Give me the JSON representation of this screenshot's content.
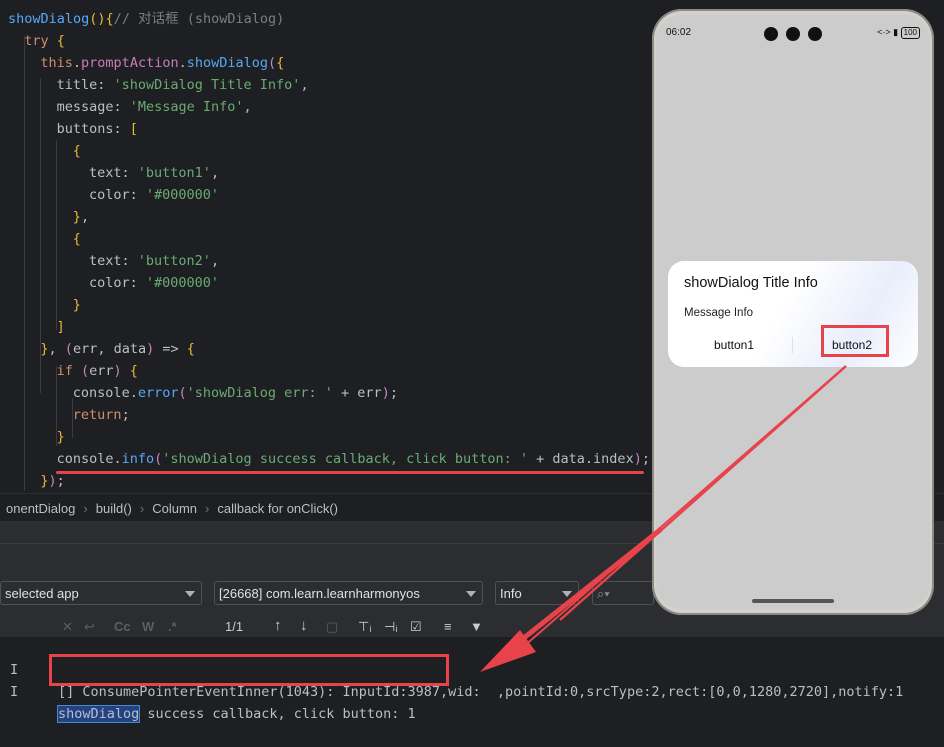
{
  "editor": {
    "lines": [
      {
        "indent": 0,
        "parts": [
          {
            "c": "fn",
            "t": "showDialog"
          },
          {
            "c": "br1",
            "t": "()"
          },
          {
            "c": "br1",
            "t": "{"
          },
          {
            "c": "cm",
            "t": "// 对话框 (showDialog)"
          }
        ]
      },
      {
        "indent": 1,
        "parts": [
          {
            "c": "kw",
            "t": "try "
          },
          {
            "c": "br1",
            "t": "{"
          }
        ]
      },
      {
        "indent": 2,
        "parts": [
          {
            "c": "kw",
            "t": "this"
          },
          {
            "c": "plain",
            "t": "."
          },
          {
            "c": "prop",
            "t": "promptAction"
          },
          {
            "c": "plain",
            "t": "."
          },
          {
            "c": "fn",
            "t": "showDialog"
          },
          {
            "c": "br2",
            "t": "("
          },
          {
            "c": "br1",
            "t": "{"
          }
        ]
      },
      {
        "indent": 3,
        "parts": [
          {
            "c": "plain",
            "t": "title: "
          },
          {
            "c": "str",
            "t": "'showDialog Title Info'"
          },
          {
            "c": "plain",
            "t": ","
          }
        ]
      },
      {
        "indent": 3,
        "parts": [
          {
            "c": "plain",
            "t": "message: "
          },
          {
            "c": "str",
            "t": "'Message Info'"
          },
          {
            "c": "plain",
            "t": ","
          }
        ]
      },
      {
        "indent": 3,
        "parts": [
          {
            "c": "plain",
            "t": "buttons: "
          },
          {
            "c": "br1",
            "t": "["
          }
        ]
      },
      {
        "indent": 4,
        "parts": [
          {
            "c": "br1",
            "t": "{"
          }
        ]
      },
      {
        "indent": 5,
        "parts": [
          {
            "c": "plain",
            "t": "text: "
          },
          {
            "c": "str",
            "t": "'button1'"
          },
          {
            "c": "plain",
            "t": ","
          }
        ]
      },
      {
        "indent": 5,
        "parts": [
          {
            "c": "plain",
            "t": "color: "
          },
          {
            "c": "str",
            "t": "'#000000'"
          }
        ]
      },
      {
        "indent": 4,
        "parts": [
          {
            "c": "br1",
            "t": "}"
          },
          {
            "c": "plain",
            "t": ","
          }
        ]
      },
      {
        "indent": 4,
        "parts": [
          {
            "c": "br1",
            "t": "{"
          }
        ]
      },
      {
        "indent": 5,
        "parts": [
          {
            "c": "plain",
            "t": "text: "
          },
          {
            "c": "str",
            "t": "'button2'"
          },
          {
            "c": "plain",
            "t": ","
          }
        ]
      },
      {
        "indent": 5,
        "parts": [
          {
            "c": "plain",
            "t": "color: "
          },
          {
            "c": "str",
            "t": "'#000000'"
          }
        ]
      },
      {
        "indent": 4,
        "parts": [
          {
            "c": "br1",
            "t": "}"
          }
        ]
      },
      {
        "indent": 3,
        "parts": [
          {
            "c": "br1",
            "t": "]"
          }
        ]
      },
      {
        "indent": 2,
        "parts": [
          {
            "c": "br1",
            "t": "}"
          },
          {
            "c": "plain",
            "t": ", "
          },
          {
            "c": "br2",
            "t": "("
          },
          {
            "c": "plain",
            "t": "err, data"
          },
          {
            "c": "br2",
            "t": ")"
          },
          {
            "c": "plain",
            "t": " => "
          },
          {
            "c": "br1",
            "t": "{"
          }
        ]
      },
      {
        "indent": 3,
        "parts": [
          {
            "c": "kw",
            "t": "if "
          },
          {
            "c": "br2",
            "t": "("
          },
          {
            "c": "plain",
            "t": "err"
          },
          {
            "c": "br2",
            "t": ")"
          },
          {
            "c": "plain",
            "t": " "
          },
          {
            "c": "br1",
            "t": "{"
          }
        ]
      },
      {
        "indent": 4,
        "parts": [
          {
            "c": "plain",
            "t": "console."
          },
          {
            "c": "fn",
            "t": "error"
          },
          {
            "c": "br2",
            "t": "("
          },
          {
            "c": "str",
            "t": "'showDialog err: '"
          },
          {
            "c": "plain",
            "t": " + err"
          },
          {
            "c": "br2",
            "t": ")"
          },
          {
            "c": "plain",
            "t": ";"
          }
        ]
      },
      {
        "indent": 4,
        "parts": [
          {
            "c": "kw",
            "t": "return"
          },
          {
            "c": "plain",
            "t": ";"
          }
        ]
      },
      {
        "indent": 3,
        "parts": [
          {
            "c": "br1",
            "t": "}"
          }
        ]
      },
      {
        "indent": 3,
        "parts": [
          {
            "c": "plain",
            "t": "console."
          },
          {
            "c": "fn",
            "t": "info"
          },
          {
            "c": "br2",
            "t": "("
          },
          {
            "c": "str",
            "t": "'showDialog success callback, click button: '"
          },
          {
            "c": "plain",
            "t": " + data.index"
          },
          {
            "c": "br2",
            "t": ")"
          },
          {
            "c": "plain",
            "t": ";"
          }
        ]
      },
      {
        "indent": 2,
        "parts": [
          {
            "c": "br1",
            "t": "}"
          },
          {
            "c": "br2",
            "t": ")"
          },
          {
            "c": "plain",
            "t": ";"
          }
        ]
      }
    ]
  },
  "breadcrumb": [
    "onentDialog",
    "build()",
    "Column",
    "callback for onClick()"
  ],
  "log_filters": {
    "device": "selected app",
    "process": "[26668] com.learn.learnharmonyos",
    "level": "Info",
    "search_placeholder": ""
  },
  "toolbar": {
    "case_label": "Cc",
    "word_label": "W",
    "regex_label": ".*",
    "match_count": "1/1"
  },
  "logs": [
    {
      "level": "I",
      "text": "[] ConsumePointerEventInner(1043): InputId:3987,wid:  ,pointId:0,srcType:2,rect:[0,0,1280,2720],notify:1"
    },
    {
      "level": "I",
      "highlight": "showDialog",
      "rest": " success callback, click button: 1"
    }
  ],
  "phone": {
    "time": "06:02",
    "status_right": "<·> ▮",
    "battery": "100",
    "dialog": {
      "title": "showDialog Title Info",
      "message": "Message Info",
      "buttons": [
        "button1",
        "button2"
      ]
    }
  },
  "colors": {
    "annotation": "#e8434b",
    "keyword": "#cf8e6d",
    "function": "#56a8f5",
    "string": "#6aab73"
  }
}
